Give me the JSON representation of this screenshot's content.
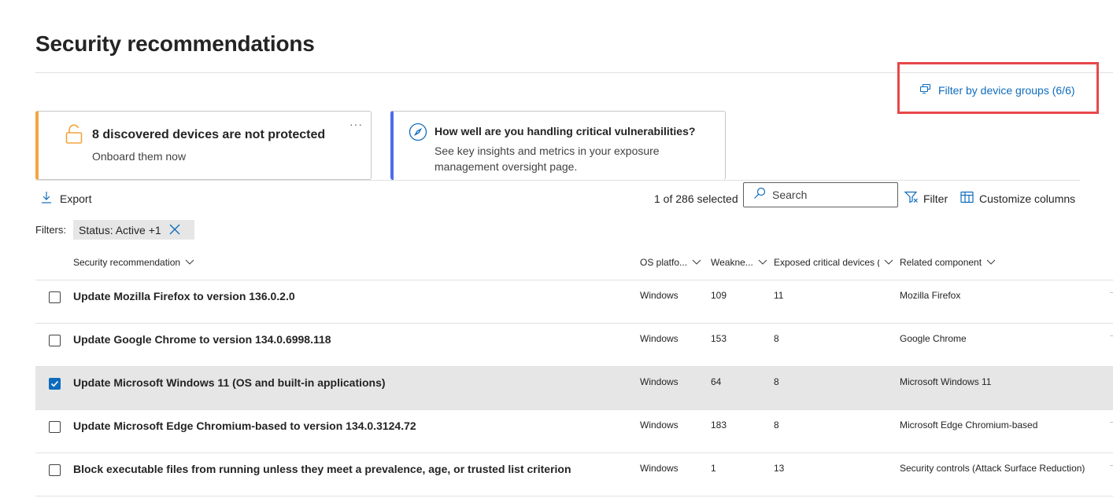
{
  "page": {
    "title": "Security recommendations",
    "filter_device_groups": "Filter by device groups (6/6)"
  },
  "cards": [
    {
      "title": "8 discovered devices are not protected",
      "subtitle": "Onboard them now",
      "more": "···",
      "accent": "#f2a440",
      "icon": "lock-open-icon"
    },
    {
      "title": "How well are you handling critical vulnerabilities?",
      "subtitle": "See key insights and metrics in your exposure management oversight page.",
      "accent": "#4f6bed",
      "icon": "compass-icon"
    }
  ],
  "toolbar": {
    "export_label": "Export",
    "selected_count": "1 of 286 selected",
    "search_placeholder": "Search",
    "filter_label": "Filter",
    "customize_label": "Customize columns"
  },
  "filters": {
    "label": "Filters:",
    "chip": "Status: Active +1"
  },
  "table": {
    "columns": [
      "Security recommendation",
      "OS platfo...",
      "Weakne...",
      "Exposed critical devices (",
      "Related component"
    ],
    "rows": [
      {
        "name": "Update Mozilla Firefox to version 136.0.2.0",
        "os": "Windows",
        "weaknesses": "109",
        "exposed": "11",
        "component": "Mozilla Firefox",
        "selected": false
      },
      {
        "name": "Update Google Chrome to version 134.0.6998.118",
        "os": "Windows",
        "weaknesses": "153",
        "exposed": "8",
        "component": "Google Chrome",
        "selected": false
      },
      {
        "name": "Update Microsoft Windows 11 (OS and built-in applications)",
        "os": "Windows",
        "weaknesses": "64",
        "exposed": "8",
        "component": "Microsoft Windows 11",
        "selected": true
      },
      {
        "name": "Update Microsoft Edge Chromium-based to version 134.0.3124.72",
        "os": "Windows",
        "weaknesses": "183",
        "exposed": "8",
        "component": "Microsoft Edge Chromium-based",
        "selected": false
      },
      {
        "name": "Block executable files from running unless they meet a prevalence, age, or trusted list criterion",
        "os": "Windows",
        "weaknesses": "1",
        "exposed": "13",
        "component": "Security controls (Attack Surface Reduction)",
        "selected": false
      }
    ]
  },
  "colors": {
    "link": "#0f6cbd",
    "highlight": "#e8474a",
    "selected_row": "#e6e6e6"
  }
}
